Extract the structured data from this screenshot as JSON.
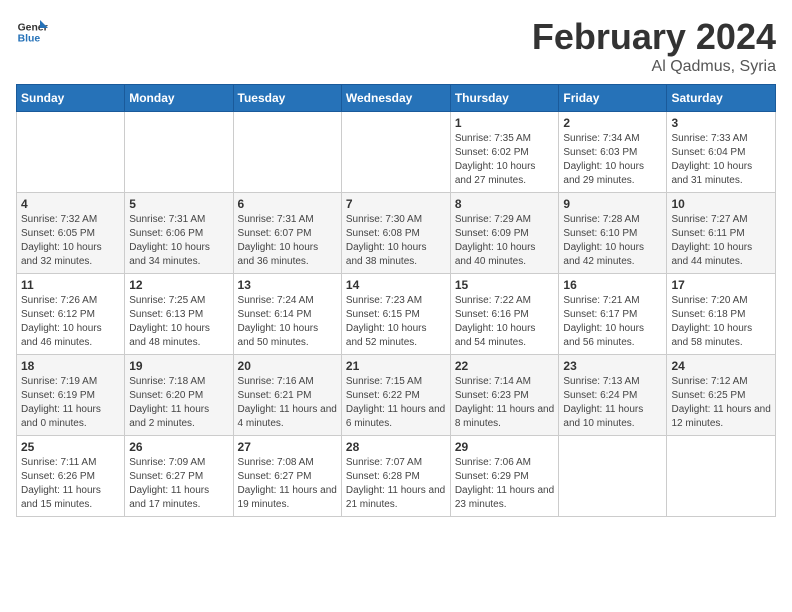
{
  "header": {
    "logo_line1": "General",
    "logo_line2": "Blue",
    "month_title": "February 2024",
    "location": "Al Qadmus, Syria"
  },
  "weekdays": [
    "Sunday",
    "Monday",
    "Tuesday",
    "Wednesday",
    "Thursday",
    "Friday",
    "Saturday"
  ],
  "weeks": [
    [
      {
        "day": "",
        "info": ""
      },
      {
        "day": "",
        "info": ""
      },
      {
        "day": "",
        "info": ""
      },
      {
        "day": "",
        "info": ""
      },
      {
        "day": "1",
        "info": "Sunrise: 7:35 AM\nSunset: 6:02 PM\nDaylight: 10 hours and 27 minutes."
      },
      {
        "day": "2",
        "info": "Sunrise: 7:34 AM\nSunset: 6:03 PM\nDaylight: 10 hours and 29 minutes."
      },
      {
        "day": "3",
        "info": "Sunrise: 7:33 AM\nSunset: 6:04 PM\nDaylight: 10 hours and 31 minutes."
      }
    ],
    [
      {
        "day": "4",
        "info": "Sunrise: 7:32 AM\nSunset: 6:05 PM\nDaylight: 10 hours and 32 minutes."
      },
      {
        "day": "5",
        "info": "Sunrise: 7:31 AM\nSunset: 6:06 PM\nDaylight: 10 hours and 34 minutes."
      },
      {
        "day": "6",
        "info": "Sunrise: 7:31 AM\nSunset: 6:07 PM\nDaylight: 10 hours and 36 minutes."
      },
      {
        "day": "7",
        "info": "Sunrise: 7:30 AM\nSunset: 6:08 PM\nDaylight: 10 hours and 38 minutes."
      },
      {
        "day": "8",
        "info": "Sunrise: 7:29 AM\nSunset: 6:09 PM\nDaylight: 10 hours and 40 minutes."
      },
      {
        "day": "9",
        "info": "Sunrise: 7:28 AM\nSunset: 6:10 PM\nDaylight: 10 hours and 42 minutes."
      },
      {
        "day": "10",
        "info": "Sunrise: 7:27 AM\nSunset: 6:11 PM\nDaylight: 10 hours and 44 minutes."
      }
    ],
    [
      {
        "day": "11",
        "info": "Sunrise: 7:26 AM\nSunset: 6:12 PM\nDaylight: 10 hours and 46 minutes."
      },
      {
        "day": "12",
        "info": "Sunrise: 7:25 AM\nSunset: 6:13 PM\nDaylight: 10 hours and 48 minutes."
      },
      {
        "day": "13",
        "info": "Sunrise: 7:24 AM\nSunset: 6:14 PM\nDaylight: 10 hours and 50 minutes."
      },
      {
        "day": "14",
        "info": "Sunrise: 7:23 AM\nSunset: 6:15 PM\nDaylight: 10 hours and 52 minutes."
      },
      {
        "day": "15",
        "info": "Sunrise: 7:22 AM\nSunset: 6:16 PM\nDaylight: 10 hours and 54 minutes."
      },
      {
        "day": "16",
        "info": "Sunrise: 7:21 AM\nSunset: 6:17 PM\nDaylight: 10 hours and 56 minutes."
      },
      {
        "day": "17",
        "info": "Sunrise: 7:20 AM\nSunset: 6:18 PM\nDaylight: 10 hours and 58 minutes."
      }
    ],
    [
      {
        "day": "18",
        "info": "Sunrise: 7:19 AM\nSunset: 6:19 PM\nDaylight: 11 hours and 0 minutes."
      },
      {
        "day": "19",
        "info": "Sunrise: 7:18 AM\nSunset: 6:20 PM\nDaylight: 11 hours and 2 minutes."
      },
      {
        "day": "20",
        "info": "Sunrise: 7:16 AM\nSunset: 6:21 PM\nDaylight: 11 hours and 4 minutes."
      },
      {
        "day": "21",
        "info": "Sunrise: 7:15 AM\nSunset: 6:22 PM\nDaylight: 11 hours and 6 minutes."
      },
      {
        "day": "22",
        "info": "Sunrise: 7:14 AM\nSunset: 6:23 PM\nDaylight: 11 hours and 8 minutes."
      },
      {
        "day": "23",
        "info": "Sunrise: 7:13 AM\nSunset: 6:24 PM\nDaylight: 11 hours and 10 minutes."
      },
      {
        "day": "24",
        "info": "Sunrise: 7:12 AM\nSunset: 6:25 PM\nDaylight: 11 hours and 12 minutes."
      }
    ],
    [
      {
        "day": "25",
        "info": "Sunrise: 7:11 AM\nSunset: 6:26 PM\nDaylight: 11 hours and 15 minutes."
      },
      {
        "day": "26",
        "info": "Sunrise: 7:09 AM\nSunset: 6:27 PM\nDaylight: 11 hours and 17 minutes."
      },
      {
        "day": "27",
        "info": "Sunrise: 7:08 AM\nSunset: 6:27 PM\nDaylight: 11 hours and 19 minutes."
      },
      {
        "day": "28",
        "info": "Sunrise: 7:07 AM\nSunset: 6:28 PM\nDaylight: 11 hours and 21 minutes."
      },
      {
        "day": "29",
        "info": "Sunrise: 7:06 AM\nSunset: 6:29 PM\nDaylight: 11 hours and 23 minutes."
      },
      {
        "day": "",
        "info": ""
      },
      {
        "day": "",
        "info": ""
      }
    ]
  ]
}
